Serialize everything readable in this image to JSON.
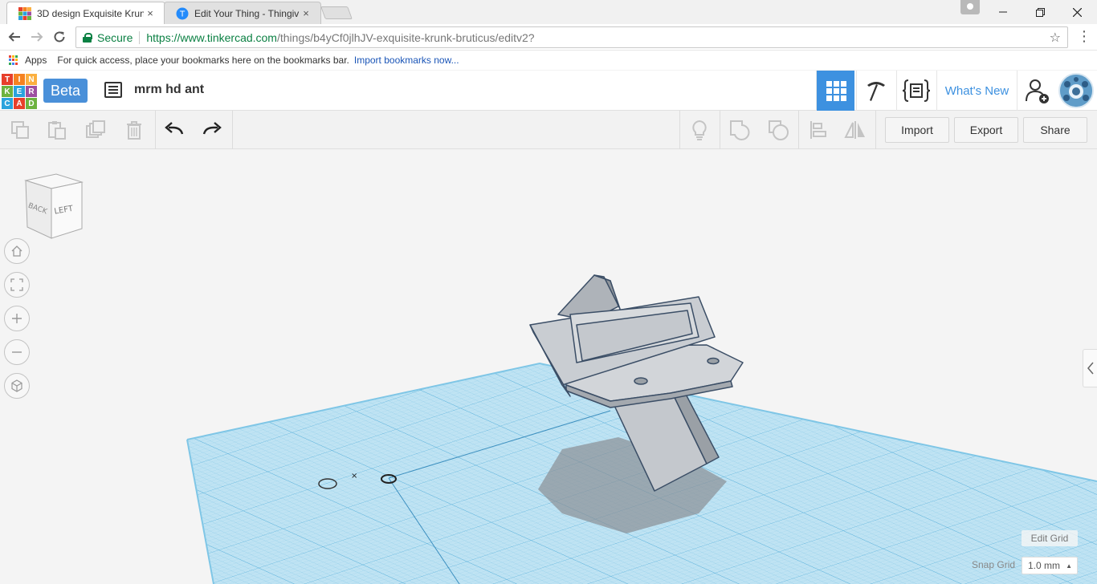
{
  "browser": {
    "tabs": [
      {
        "title": "3D design Exquisite Krun"
      },
      {
        "title": "Edit Your Thing - Thingiv"
      }
    ],
    "close_glyph": "×",
    "url": {
      "secure_label": "Secure",
      "host": "https://www.tinkercad.com",
      "path": "/things/b4yCf0jlhJV-exquisite-krunk-bruticus/editv2?"
    },
    "bookmarks": {
      "apps_label": "Apps",
      "hint": "For quick access, place your bookmarks here on the bookmarks bar.",
      "import_link": "Import bookmarks now..."
    }
  },
  "header": {
    "logo_letters": [
      "T",
      "I",
      "N",
      "K",
      "E",
      "R",
      "C",
      "A",
      "D"
    ],
    "logo_colors": [
      "#e73f2b",
      "#f58220",
      "#fbb040",
      "#6db33f",
      "#2aa3dd",
      "#9e4fa0",
      "#2aa3dd",
      "#e73f2b",
      "#6db33f"
    ],
    "beta_label": "Beta",
    "design_name": "mrm hd ant",
    "whats_new": "What's New"
  },
  "toolbar": {
    "import_label": "Import",
    "export_label": "Export",
    "share_label": "Share"
  },
  "viewcube": {
    "back_label": "BACK",
    "left_label": "LEFT"
  },
  "grid_controls": {
    "edit_grid": "Edit Grid",
    "snap_label": "Snap Grid",
    "snap_value": "1.0 mm"
  },
  "colors": {
    "accent": "#3d91e0",
    "grid_fill": "#bfe3f3",
    "grid_line": "#7fc6e6",
    "shape_fill": "#c9cdd2",
    "shape_edge": "#3b4e66"
  }
}
